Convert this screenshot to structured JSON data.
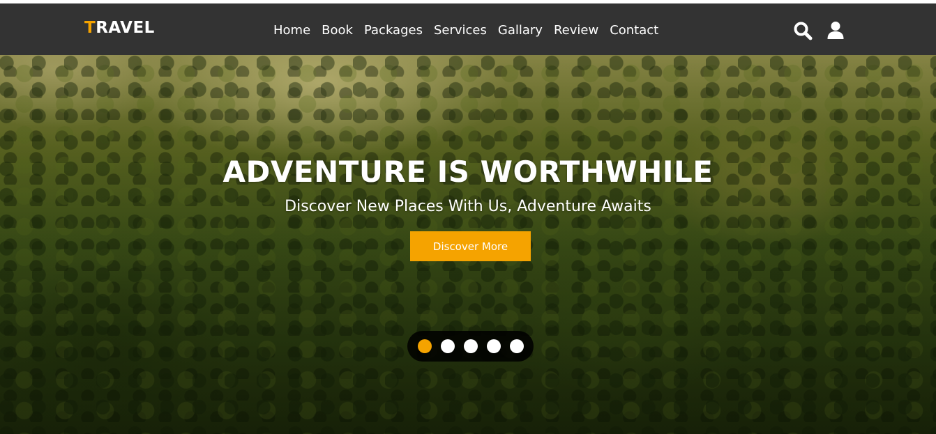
{
  "brand": {
    "logo_first": "T",
    "logo_rest": "RAVEL",
    "accent_color": "#f5a300"
  },
  "header": {
    "background": "#333333",
    "nav": [
      "Home",
      "Book",
      "Packages",
      "Services",
      "Gallary",
      "Review",
      "Contact"
    ],
    "icons": [
      "search-icon",
      "user-icon"
    ]
  },
  "hero": {
    "title": "ADVENTURE IS WORTHWHILE",
    "subtitle": "Discover New Places With Us, Adventure Awaits",
    "cta_label": "Discover More",
    "slides_total": 5,
    "active_slide": 1
  }
}
